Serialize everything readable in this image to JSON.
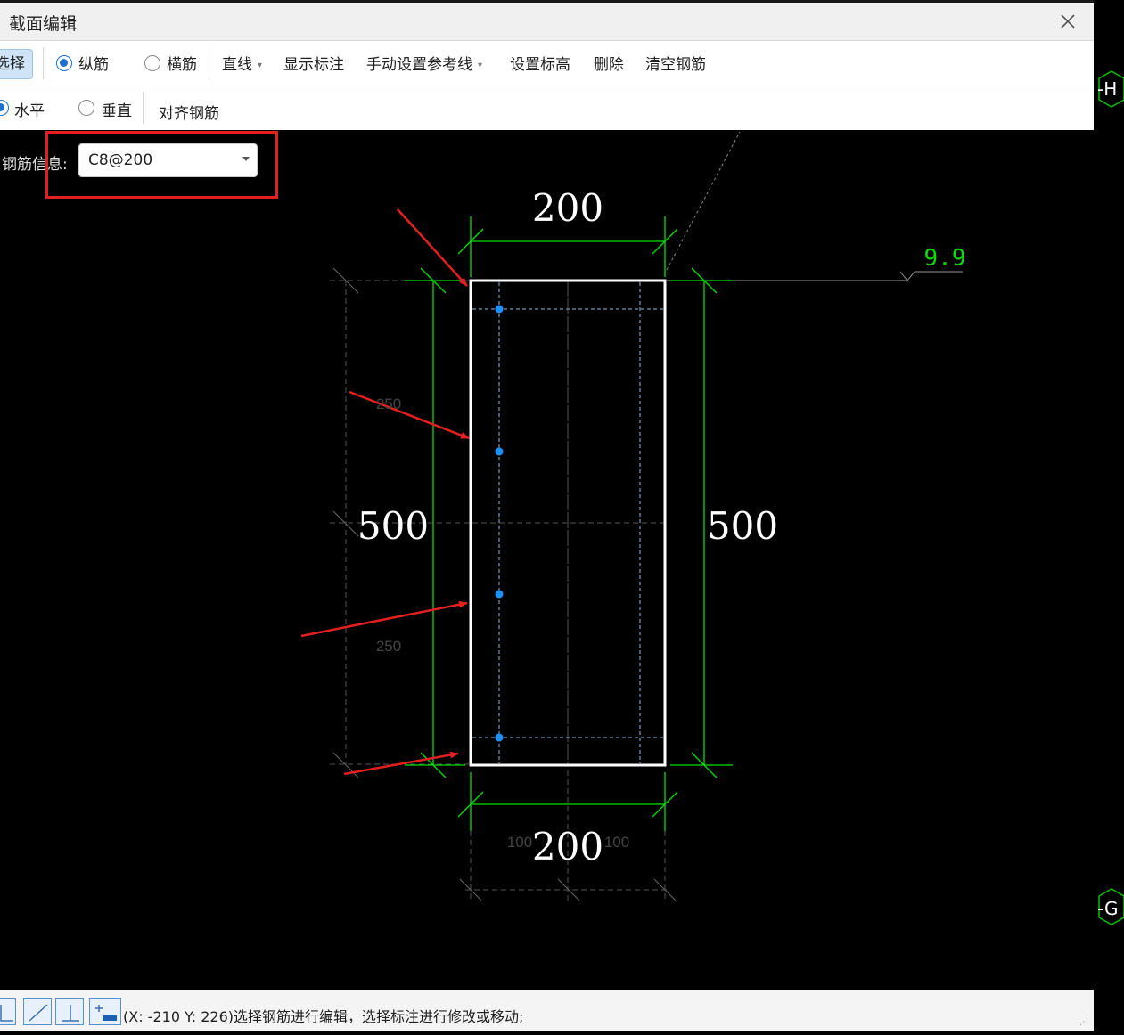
{
  "window": {
    "title": "截面编辑"
  },
  "toolbar1": {
    "select": "选择",
    "radio_longitudinal": "纵筋",
    "radio_transverse": "横筋",
    "line_tool": "直线",
    "show_annotation": "显示标注",
    "manual_refline": "手动设置参考线",
    "set_elevation": "设置标高",
    "delete": "删除",
    "clear_rebar": "清空钢筋"
  },
  "toolbar2": {
    "radio_horizontal": "水平",
    "radio_vertical": "垂直",
    "align_rebar": "对齐钢筋"
  },
  "rebar_info": {
    "label": "钢筋信息:",
    "value": "C8@200"
  },
  "drawing": {
    "top_width": "200",
    "bottom_width": "200",
    "left_height": "500",
    "right_height": "500",
    "elevation": "9.9",
    "seg_upper": "250",
    "seg_lower": "250",
    "half_left": "100",
    "half_right": "100",
    "colors": {
      "dimension": "#00e000",
      "section": "#ffffff",
      "rebar": "#1e90ff",
      "annotation_arrow": "#e22020"
    }
  },
  "side_labels": {
    "top": "-H",
    "bottom": "-G"
  },
  "status": {
    "text": "(X: -210 Y: 226)选择钢筋进行编辑，选择标注进行修改或移动;"
  }
}
